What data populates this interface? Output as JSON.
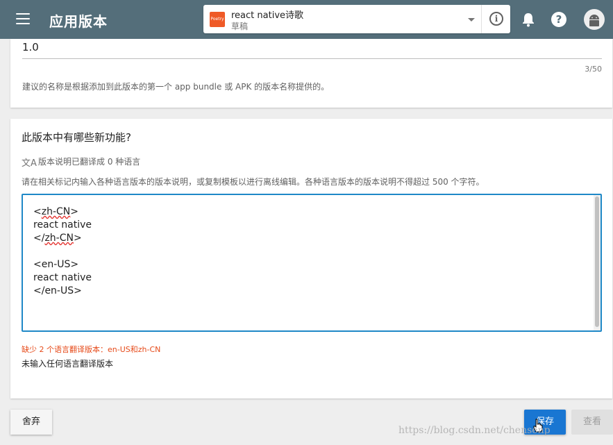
{
  "appbar": {
    "title": "应用版本",
    "app_selector": {
      "logo_text": "Poetry",
      "app_name": "react native诗歌",
      "status": "草稿"
    },
    "colors": {
      "bar": "#546e7a",
      "logo": "#ef5a27"
    }
  },
  "version_card": {
    "value": "1.0",
    "counter": "3/50",
    "helper": "建议的名称是根据添加到此版本的第一个 app bundle 或 APK 的版本名称提供的。"
  },
  "release_notes": {
    "title": "此版本中有哪些新功能?",
    "translate_icon": "translate-icon",
    "translation_status": "版本说明已翻译成 0 种语言",
    "instructions": "请在相关标记内输入各种语言版本的版本说明，或复制模板以进行离线编辑。各种语言版本的版本说明不得超过 500 个字符。",
    "text_lines": {
      "l1_open": "<",
      "l1_tag": "zh-CN",
      "l1_close": ">",
      "l2": "react native",
      "l3_open": "</",
      "l3_tag": "zh-CN",
      "l3_close": ">",
      "l5": "<en-US>",
      "l6": "react native",
      "l7": "</en-US>"
    },
    "error": "缺少 2 个语言翻译版本：en-US和zh-CN",
    "untranslated": "未输入任何语言翻译版本",
    "colors": {
      "focus_border": "#1e88c7",
      "error": "#e64a19"
    }
  },
  "actions": {
    "discard": "舍弃",
    "save": "保存",
    "view": "查看",
    "save_color": "#1976d2"
  },
  "watermark": "https://blog.csdn.net/chensenp"
}
